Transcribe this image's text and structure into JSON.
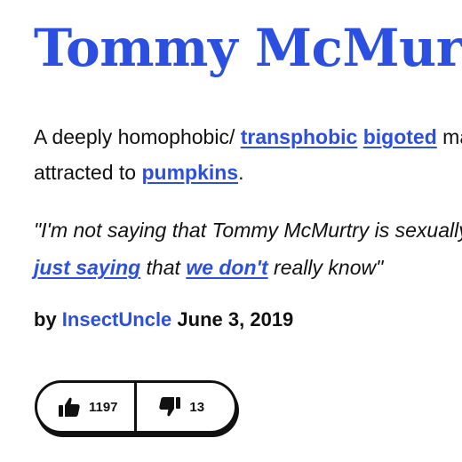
{
  "entry": {
    "word": "Tommy McMurtry",
    "definition": {
      "line1": [
        {
          "text": "A deeply homophobic/ ",
          "link": false
        },
        {
          "text": "transphobic",
          "link": true
        },
        {
          "text": " ",
          "link": false
        },
        {
          "text": "bigoted",
          "link": true
        },
        {
          "text": " man who is",
          "link": false
        }
      ],
      "line2": [
        {
          "text": "attracted to ",
          "link": false
        },
        {
          "text": "pumpkins",
          "link": true
        },
        {
          "text": ".",
          "link": false
        }
      ]
    },
    "example": {
      "line1_text": "\"I'm not saying that Tommy McMurtry is sexually attracted to pumpkins, I'm",
      "line2_link1": "just saying",
      "line2_text1": " that ",
      "line2_link2": "we don't",
      "line2_text2": " really know\""
    },
    "byline": {
      "prefix": "by ",
      "author": "InsectUncle",
      "date": "June 3, 2019"
    },
    "votes": {
      "up_count": "1197",
      "down_count": "13",
      "up_icon": "thumbs-up-icon",
      "down_icon": "thumbs-down-icon"
    }
  },
  "colors": {
    "accent": "#2b4fe0",
    "text": "#111111",
    "background": "#ffffff"
  }
}
